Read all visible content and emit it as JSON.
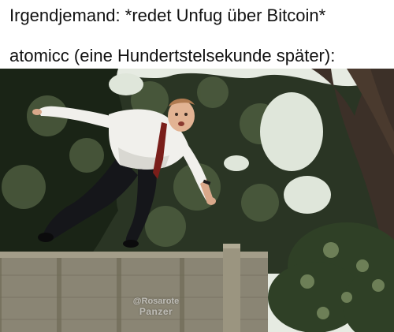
{
  "captions": {
    "line1": "Irgendjemand: *redet Unfug über Bitcoin*",
    "line2": "atomicc (eine Hundertstelsekunde später):"
  },
  "photo": {
    "description_icon": "man-jumping-fence-photo",
    "watermark": {
      "line1": "@Rosarote",
      "line2": "Panzer"
    }
  },
  "colors": {
    "background": "#ffffff",
    "text": "#111111",
    "sky": "#e9eee6",
    "foliage_dark": "#1f2a1b",
    "foliage_mid": "#3d4a33",
    "fence": "#8b8675",
    "shirt": "#f4f4f2",
    "tie": "#7a1e1a",
    "trousers": "#15161a"
  }
}
